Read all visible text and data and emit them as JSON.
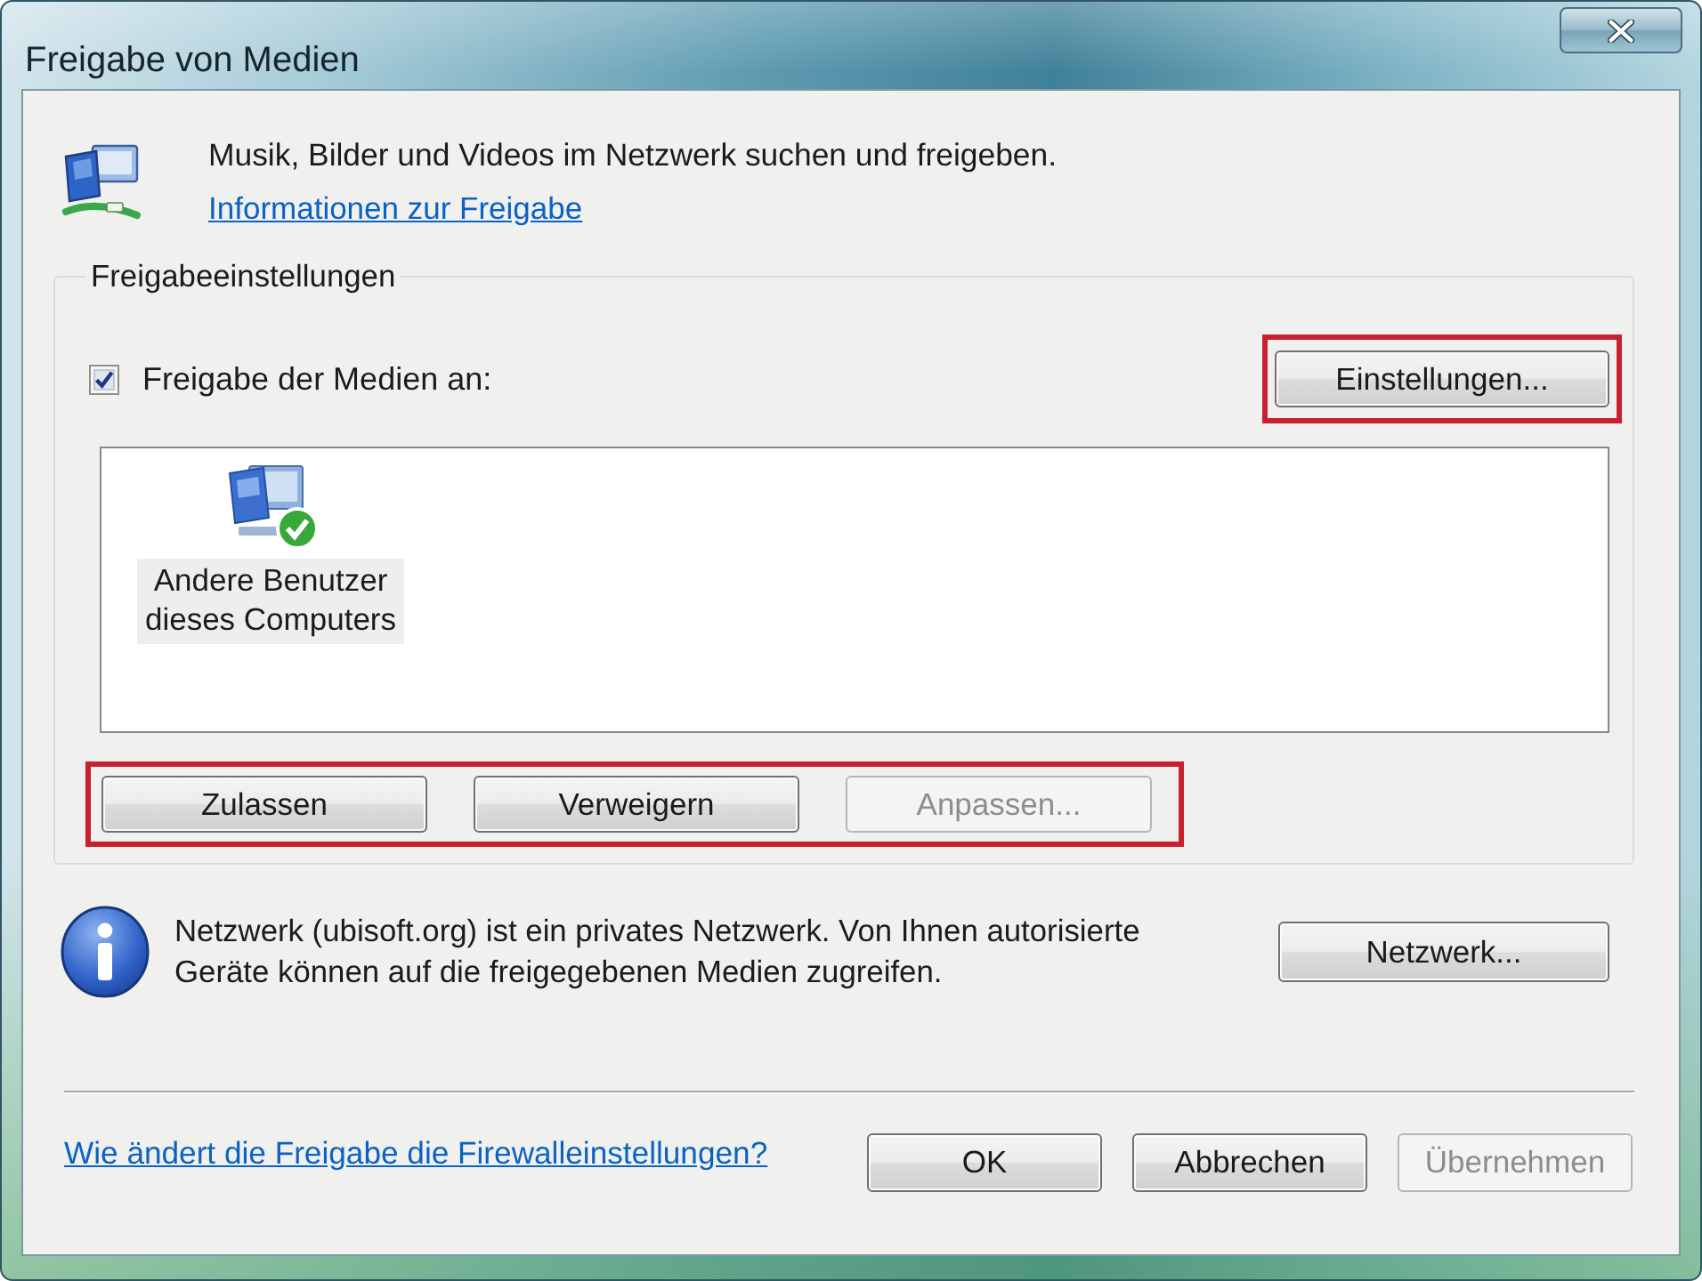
{
  "window": {
    "title": "Freigabe von Medien"
  },
  "header": {
    "text": "Musik, Bilder und Videos im Netzwerk suchen und freigeben.",
    "link": "Informationen zur Freigabe"
  },
  "sharing": {
    "title": "Freigabeeinstellungen",
    "checkbox": {
      "label": "Freigabe der Medien an:",
      "checked": true
    },
    "settings_button": {
      "label": "Einstellungen...",
      "disabled": false,
      "highlighted": true
    },
    "devices": [
      {
        "label": "Andere Benutzer dieses Computers",
        "allowed": true,
        "selected": true
      }
    ],
    "actions": {
      "highlighted": true,
      "buttons": [
        {
          "label": "Zulassen",
          "disabled": false
        },
        {
          "label": "Verweigern",
          "disabled": false
        },
        {
          "label": "Anpassen...",
          "disabled": true
        }
      ]
    }
  },
  "network": {
    "text": "Netzwerk (ubisoft.org) ist ein privates Netzwerk. Von Ihnen autorisierte Geräte können auf die freigegebenen Medien zugreifen.",
    "button": {
      "label": "Netzwerk...",
      "disabled": false
    }
  },
  "footer": {
    "link": "Wie ändert die Freigabe die Firewalleinstellungen?",
    "buttons": [
      {
        "label": "OK",
        "disabled": false
      },
      {
        "label": "Abbrechen",
        "disabled": false
      },
      {
        "label": "Übernehmen",
        "disabled": true
      }
    ]
  }
}
